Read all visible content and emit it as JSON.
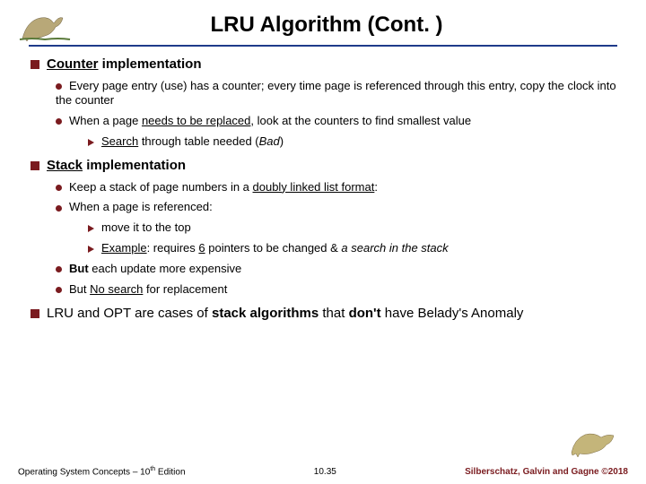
{
  "title": "LRU Algorithm (Cont. )",
  "sections": [
    {
      "heading_pre": "",
      "heading_u": "Counter",
      "heading_post": " implementation",
      "items": [
        {
          "text": "Every page entry (use) has a counter; every time page is referenced through this entry, copy the clock into the counter"
        },
        {
          "text_a": "When a page ",
          "text_u": "needs to be replaced",
          "text_b": ", look at the counters to find smallest value",
          "subs": [
            {
              "pre": "",
              "u": "Search",
              "mid": " through table needed (",
              "i": "Bad",
              "post": ")"
            }
          ]
        }
      ]
    },
    {
      "heading_pre": "",
      "heading_u": "Stack",
      "heading_post": " implementation",
      "items": [
        {
          "text_a": "Keep a stack of page numbers in a ",
          "text_u": "doubly linked list format",
          "text_b": ":"
        },
        {
          "text": "When a page is referenced:",
          "subs": [
            {
              "plain": "move it to the top"
            },
            {
              "pre": "",
              "u": "Example",
              "mid": ": requires ",
              "u2": "6",
              "post2": " pointers to be changed & ",
              "i2": "a search in the stack"
            }
          ]
        },
        {
          "b_pre": "But",
          "plain_post": " each update more expensive"
        },
        {
          "plain_pre": "But ",
          "u": "No search",
          "plain_post": " for replacement"
        }
      ]
    }
  ],
  "final": {
    "pre": "LRU and OPT are cases of ",
    "b1": "stack algorithms",
    "mid": " that ",
    "b2": "don't",
    "post": " have Belady's Anomaly"
  },
  "footer": {
    "left_a": "Operating System Concepts – 10",
    "left_sup": "th",
    "left_b": " Edition",
    "center": "10.35",
    "right": "Silberschatz, Galvin and Gagne ©2018"
  },
  "icons": {
    "dino_small": "dino-small-icon",
    "dino_big": "dino-big-icon"
  }
}
